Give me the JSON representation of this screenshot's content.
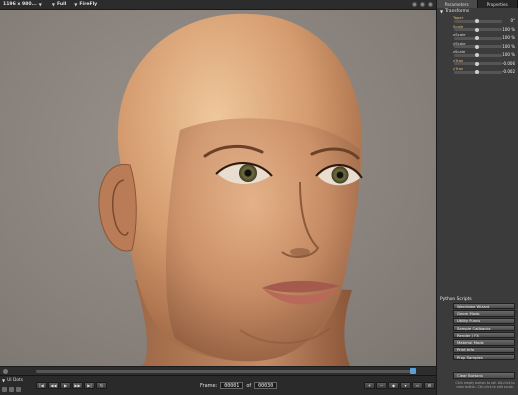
{
  "topbar": {
    "resolution": "1196 x 980...",
    "view": "Full",
    "renderer": "FireFly"
  },
  "viewport": {
    "subject": "rendered 3D bald female head",
    "background_color": "#8f8882"
  },
  "bottombar": {
    "ui_dots_label": "UI Dots",
    "frame_label": "Frame:",
    "frame_current": "00001",
    "frame_of": "of",
    "frame_total": "00030"
  },
  "panel": {
    "tabs": [
      {
        "label": "Parameters"
      },
      {
        "label": "Properties"
      }
    ],
    "transforms_title": "Transforms",
    "params": [
      {
        "name": "Taper",
        "value": "0°",
        "highlight": true
      },
      {
        "name": "Scale",
        "value": "100 %",
        "highlight": true
      },
      {
        "name": "xScale",
        "value": "100 %",
        "highlight": false
      },
      {
        "name": "yScale",
        "value": "100 %",
        "highlight": false
      },
      {
        "name": "zScale",
        "value": "100 %",
        "highlight": false
      },
      {
        "name": "xTran",
        "value": "-0.006",
        "highlight": true
      },
      {
        "name": "yTran",
        "value": "-0.002",
        "highlight": true
      }
    ],
    "python_scripts_title": "Python Scripts",
    "scripts": [
      {
        "label": "Wardrobe Wizard"
      },
      {
        "label": "Geom Mods"
      },
      {
        "label": "Utility Funcs"
      },
      {
        "label": "Sample Callbacks"
      },
      {
        "label": "Render / FX"
      },
      {
        "label": "Material Mods"
      },
      {
        "label": "Print Info"
      },
      {
        "label": "Prop Samples"
      }
    ],
    "clear_buttons_label": "Clear Buttons",
    "note": "Click empty button to set. Alt-click to clear button. Ctrl-click to edit script."
  },
  "colors": {
    "accent": "#5aa0d8",
    "param_label": "#e8b87a",
    "panel_bg": "#3b3b3b"
  }
}
